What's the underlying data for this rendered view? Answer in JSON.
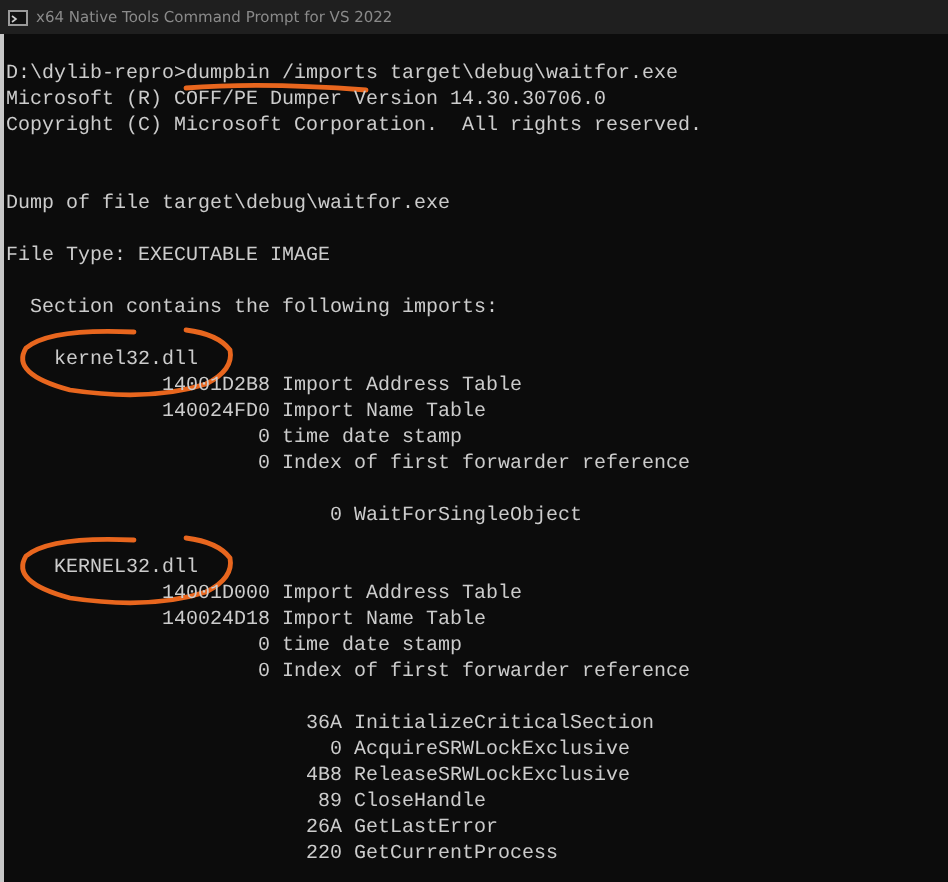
{
  "window": {
    "title": "x64 Native Tools Command Prompt for VS 2022"
  },
  "lines": [
    {
      "kind": "command",
      "prompt": "D:\\dylib-repro>",
      "command": "dumpbin /imports target\\debug\\waitfor.exe",
      "underlined": true
    },
    {
      "kind": "text",
      "text": "Microsoft (R) COFF/PE Dumper Version 14.30.30706.0",
      "circled": false
    },
    {
      "kind": "text",
      "text": "Copyright (C) Microsoft Corporation.  All rights reserved.",
      "circled": false
    },
    {
      "kind": "blank"
    },
    {
      "kind": "blank"
    },
    {
      "kind": "text",
      "text": "Dump of file target\\debug\\waitfor.exe",
      "circled": false
    },
    {
      "kind": "blank"
    },
    {
      "kind": "text",
      "text": "File Type: EXECUTABLE IMAGE",
      "circled": false
    },
    {
      "kind": "blank"
    },
    {
      "kind": "text",
      "text": "  Section contains the following imports:",
      "circled": false
    },
    {
      "kind": "blank"
    },
    {
      "kind": "text",
      "text": "    kernel32.dll",
      "circled": true
    },
    {
      "kind": "text",
      "text": "             14001D2B8 Import Address Table",
      "circled": false
    },
    {
      "kind": "text",
      "text": "             140024FD0 Import Name Table",
      "circled": false
    },
    {
      "kind": "text",
      "text": "                     0 time date stamp",
      "circled": false
    },
    {
      "kind": "text",
      "text": "                     0 Index of first forwarder reference",
      "circled": false
    },
    {
      "kind": "blank"
    },
    {
      "kind": "text",
      "text": "                           0 WaitForSingleObject",
      "circled": false
    },
    {
      "kind": "blank"
    },
    {
      "kind": "text",
      "text": "    KERNEL32.dll",
      "circled": true
    },
    {
      "kind": "text",
      "text": "             14001D000 Import Address Table",
      "circled": false
    },
    {
      "kind": "text",
      "text": "             140024D18 Import Name Table",
      "circled": false
    },
    {
      "kind": "text",
      "text": "                     0 time date stamp",
      "circled": false
    },
    {
      "kind": "text",
      "text": "                     0 Index of first forwarder reference",
      "circled": false
    },
    {
      "kind": "blank"
    },
    {
      "kind": "text",
      "text": "                         36A InitializeCriticalSection",
      "circled": false
    },
    {
      "kind": "text",
      "text": "                           0 AcquireSRWLockExclusive",
      "circled": false
    },
    {
      "kind": "text",
      "text": "                         4B8 ReleaseSRWLockExclusive",
      "circled": false
    },
    {
      "kind": "text",
      "text": "                          89 CloseHandle",
      "circled": false
    },
    {
      "kind": "text",
      "text": "                         26A GetLastError",
      "circled": false
    },
    {
      "kind": "text",
      "text": "                         220 GetCurrentProcess",
      "circled": false
    }
  ]
}
